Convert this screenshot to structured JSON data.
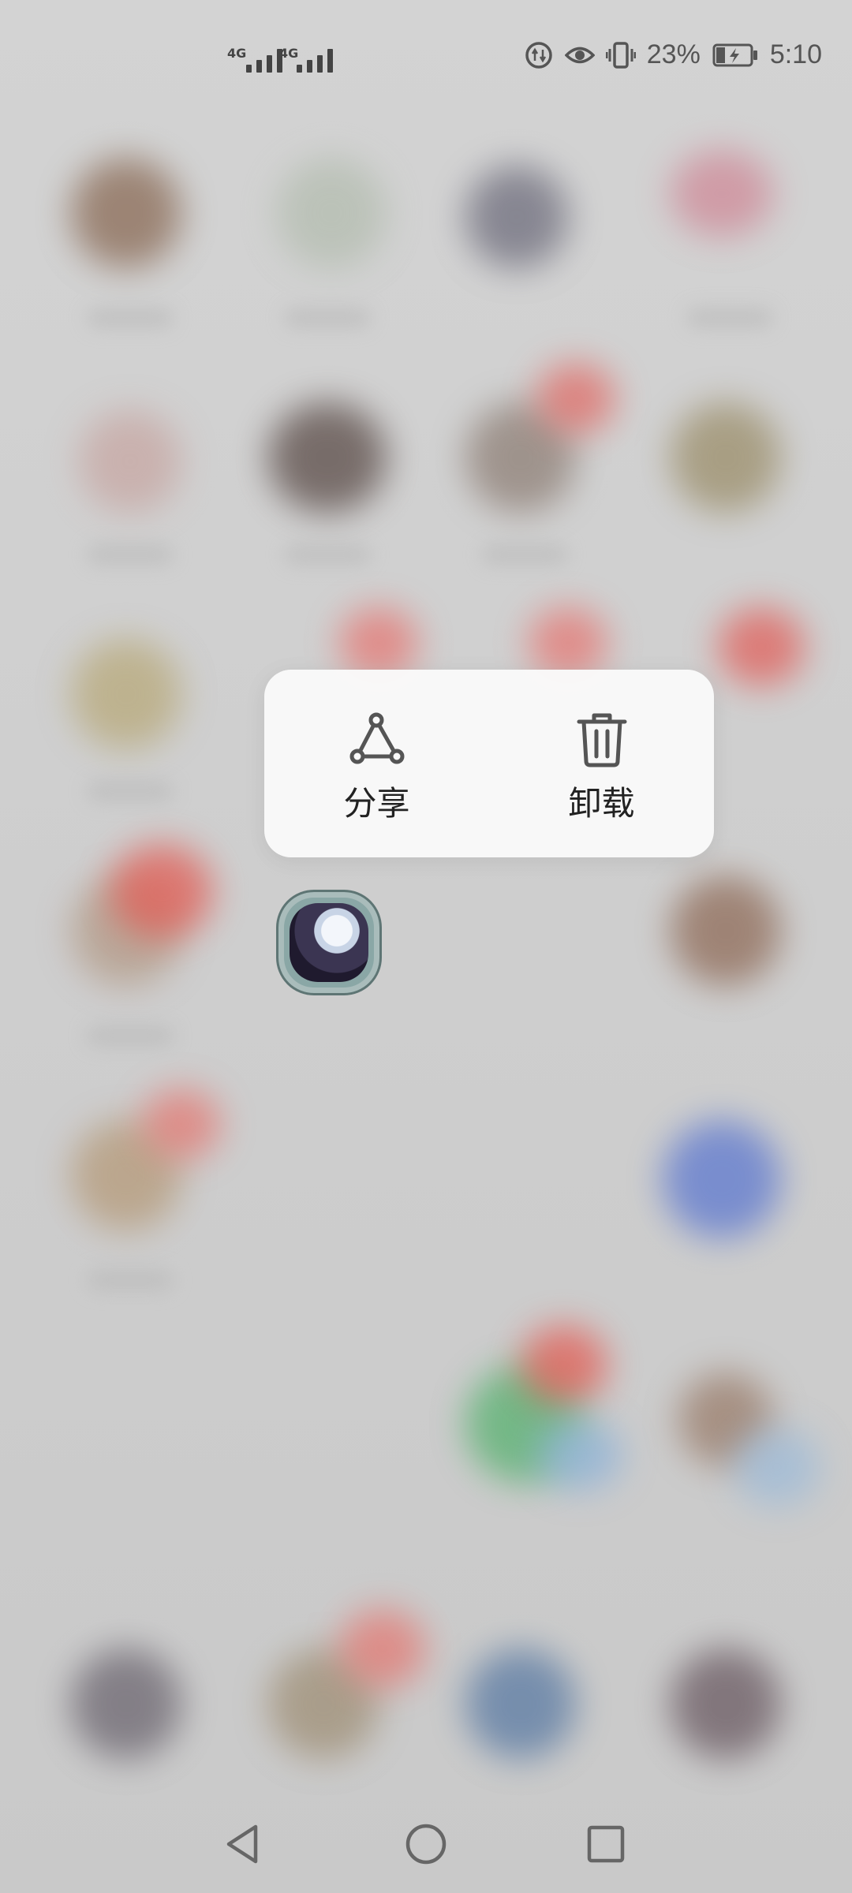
{
  "status_bar": {
    "network_1": "4G",
    "network_2": "4G",
    "battery_percent": "23%",
    "time": "5:10"
  },
  "popup": {
    "share_label": "分享",
    "uninstall_label": "卸载"
  },
  "icons": {
    "share": "share-icon",
    "uninstall": "trash-icon",
    "back": "back-triangle-icon",
    "home": "home-circle-icon",
    "recents": "recents-square-icon"
  },
  "colors": {
    "popup_bg": "#fafafa",
    "text": "#222222",
    "icon": "#555555"
  }
}
